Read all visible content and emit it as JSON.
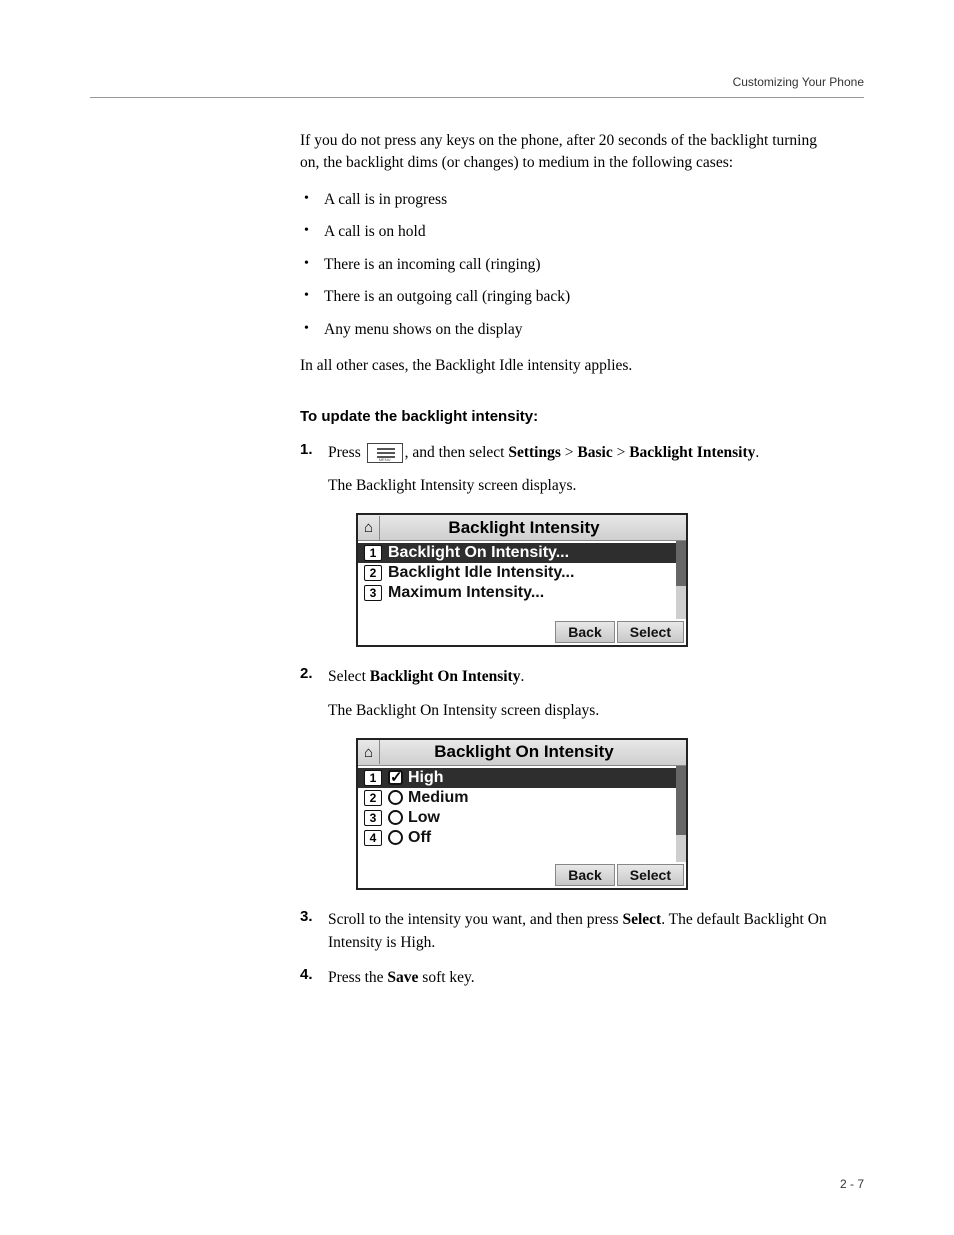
{
  "header": {
    "section": "Customizing Your Phone"
  },
  "intro": "If you do not press any keys on the phone, after 20 seconds of the backlight turning on, the backlight dims (or changes) to medium in the following cases:",
  "bullets": [
    "A call is in progress",
    "A call is on hold",
    "There is an incoming call (ringing)",
    "There is an outgoing call (ringing back)",
    "Any menu shows on the display"
  ],
  "after_bullets": "In all other cases, the Backlight Idle intensity applies.",
  "procedure_heading": "To update the backlight intensity:",
  "steps": {
    "s1_a": "Press ",
    "s1_b": ", and then select ",
    "s1_path_settings": "Settings",
    "s1_gt1": " > ",
    "s1_path_basic": "Basic",
    "s1_gt2": " > ",
    "s1_path_backlight": "Backlight Intensity",
    "s1_c": ".",
    "s1_sub": "The Backlight Intensity screen displays.",
    "s2_a": "Select ",
    "s2_bold": "Backlight On Intensity",
    "s2_b": ".",
    "s2_sub": "The Backlight On Intensity screen displays.",
    "s3_a": "Scroll to the intensity you want, and then press ",
    "s3_bold": "Select",
    "s3_b": ". The default Backlight On Intensity is High.",
    "s4_a": "Press the ",
    "s4_bold": "Save",
    "s4_b": " soft key."
  },
  "screen1": {
    "title": "Backlight Intensity",
    "items": [
      {
        "num": "1",
        "label": "Backlight On Intensity..."
      },
      {
        "num": "2",
        "label": "Backlight Idle Intensity..."
      },
      {
        "num": "3",
        "label": "Maximum Intensity..."
      }
    ],
    "softkeys": {
      "back": "Back",
      "select": "Select"
    }
  },
  "screen2": {
    "title": "Backlight On Intensity",
    "items": [
      {
        "num": "1",
        "label": "High"
      },
      {
        "num": "2",
        "label": "Medium"
      },
      {
        "num": "3",
        "label": "Low"
      },
      {
        "num": "4",
        "label": "Off"
      }
    ],
    "softkeys": {
      "back": "Back",
      "select": "Select"
    }
  },
  "page_number": "2 - 7"
}
